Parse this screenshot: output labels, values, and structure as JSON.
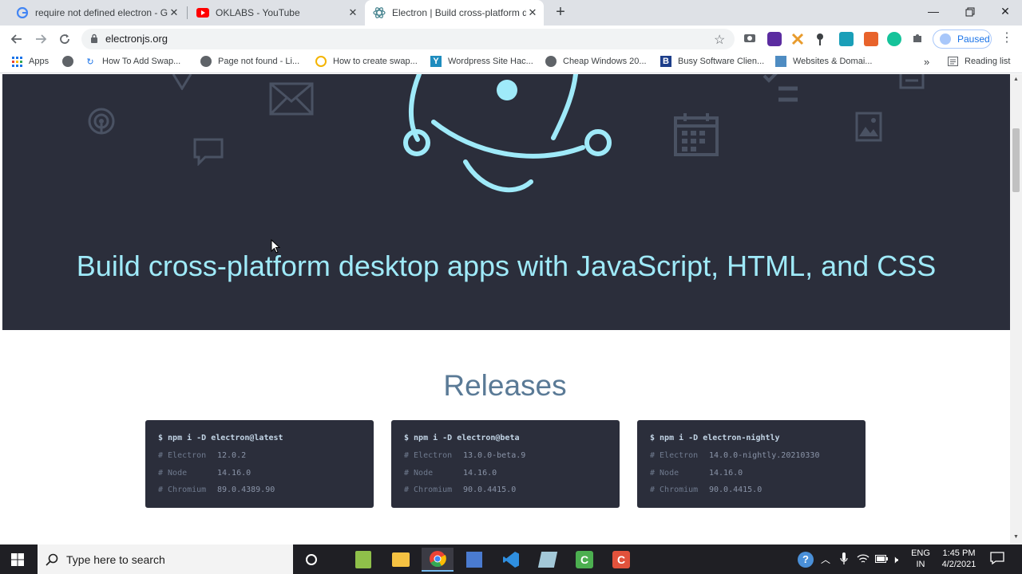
{
  "browser": {
    "tabs": [
      {
        "title": "require not defined electron - Go",
        "favicon": "google-icon"
      },
      {
        "title": "OKLABS - YouTube",
        "favicon": "youtube-icon"
      },
      {
        "title": "Electron | Build cross-platform de",
        "favicon": "electron-icon"
      }
    ],
    "url": "electronjs.org",
    "profile_label": "Paused",
    "reading_list": "Reading list",
    "bookmarks": [
      {
        "label": "Apps"
      },
      {
        "label": ""
      },
      {
        "label": "How To Add Swap..."
      },
      {
        "label": "Page not found - Li..."
      },
      {
        "label": "How to create swap..."
      },
      {
        "label": "Wordpress Site Hac..."
      },
      {
        "label": "Cheap Windows 20..."
      },
      {
        "label": "Busy Software Clien..."
      },
      {
        "label": "Websites & Domai..."
      }
    ],
    "more": "»"
  },
  "page": {
    "tagline": "Build cross-platform desktop apps with JavaScript, HTML, and CSS",
    "releases_heading": "Releases",
    "releases": [
      {
        "cmd": "$ npm i -D electron@latest",
        "rows": [
          {
            "k": "# Electron",
            "v": "12.0.2"
          },
          {
            "k": "# Node",
            "v": "14.16.0"
          },
          {
            "k": "# Chromium",
            "v": "89.0.4389.90"
          }
        ]
      },
      {
        "cmd": "$ npm i -D electron@beta",
        "rows": [
          {
            "k": "# Electron",
            "v": "13.0.0-beta.9"
          },
          {
            "k": "# Node",
            "v": "14.16.0"
          },
          {
            "k": "# Chromium",
            "v": "90.0.4415.0"
          }
        ]
      },
      {
        "cmd": "$ npm i -D electron-nightly",
        "rows": [
          {
            "k": "# Electron",
            "v": "14.0.0-nightly.20210330"
          },
          {
            "k": "# Node",
            "v": "14.16.0"
          },
          {
            "k": "# Chromium",
            "v": "90.0.4415.0"
          }
        ]
      }
    ]
  },
  "taskbar": {
    "search_placeholder": "Type here to search",
    "lang_top": "ENG",
    "lang_bottom": "IN",
    "time": "1:45 PM",
    "date": "4/2/2021"
  },
  "colors": {
    "hero_bg": "#2b2e3b",
    "electron_cyan": "#9feaf9",
    "releases_heading": "#5a7a96"
  }
}
